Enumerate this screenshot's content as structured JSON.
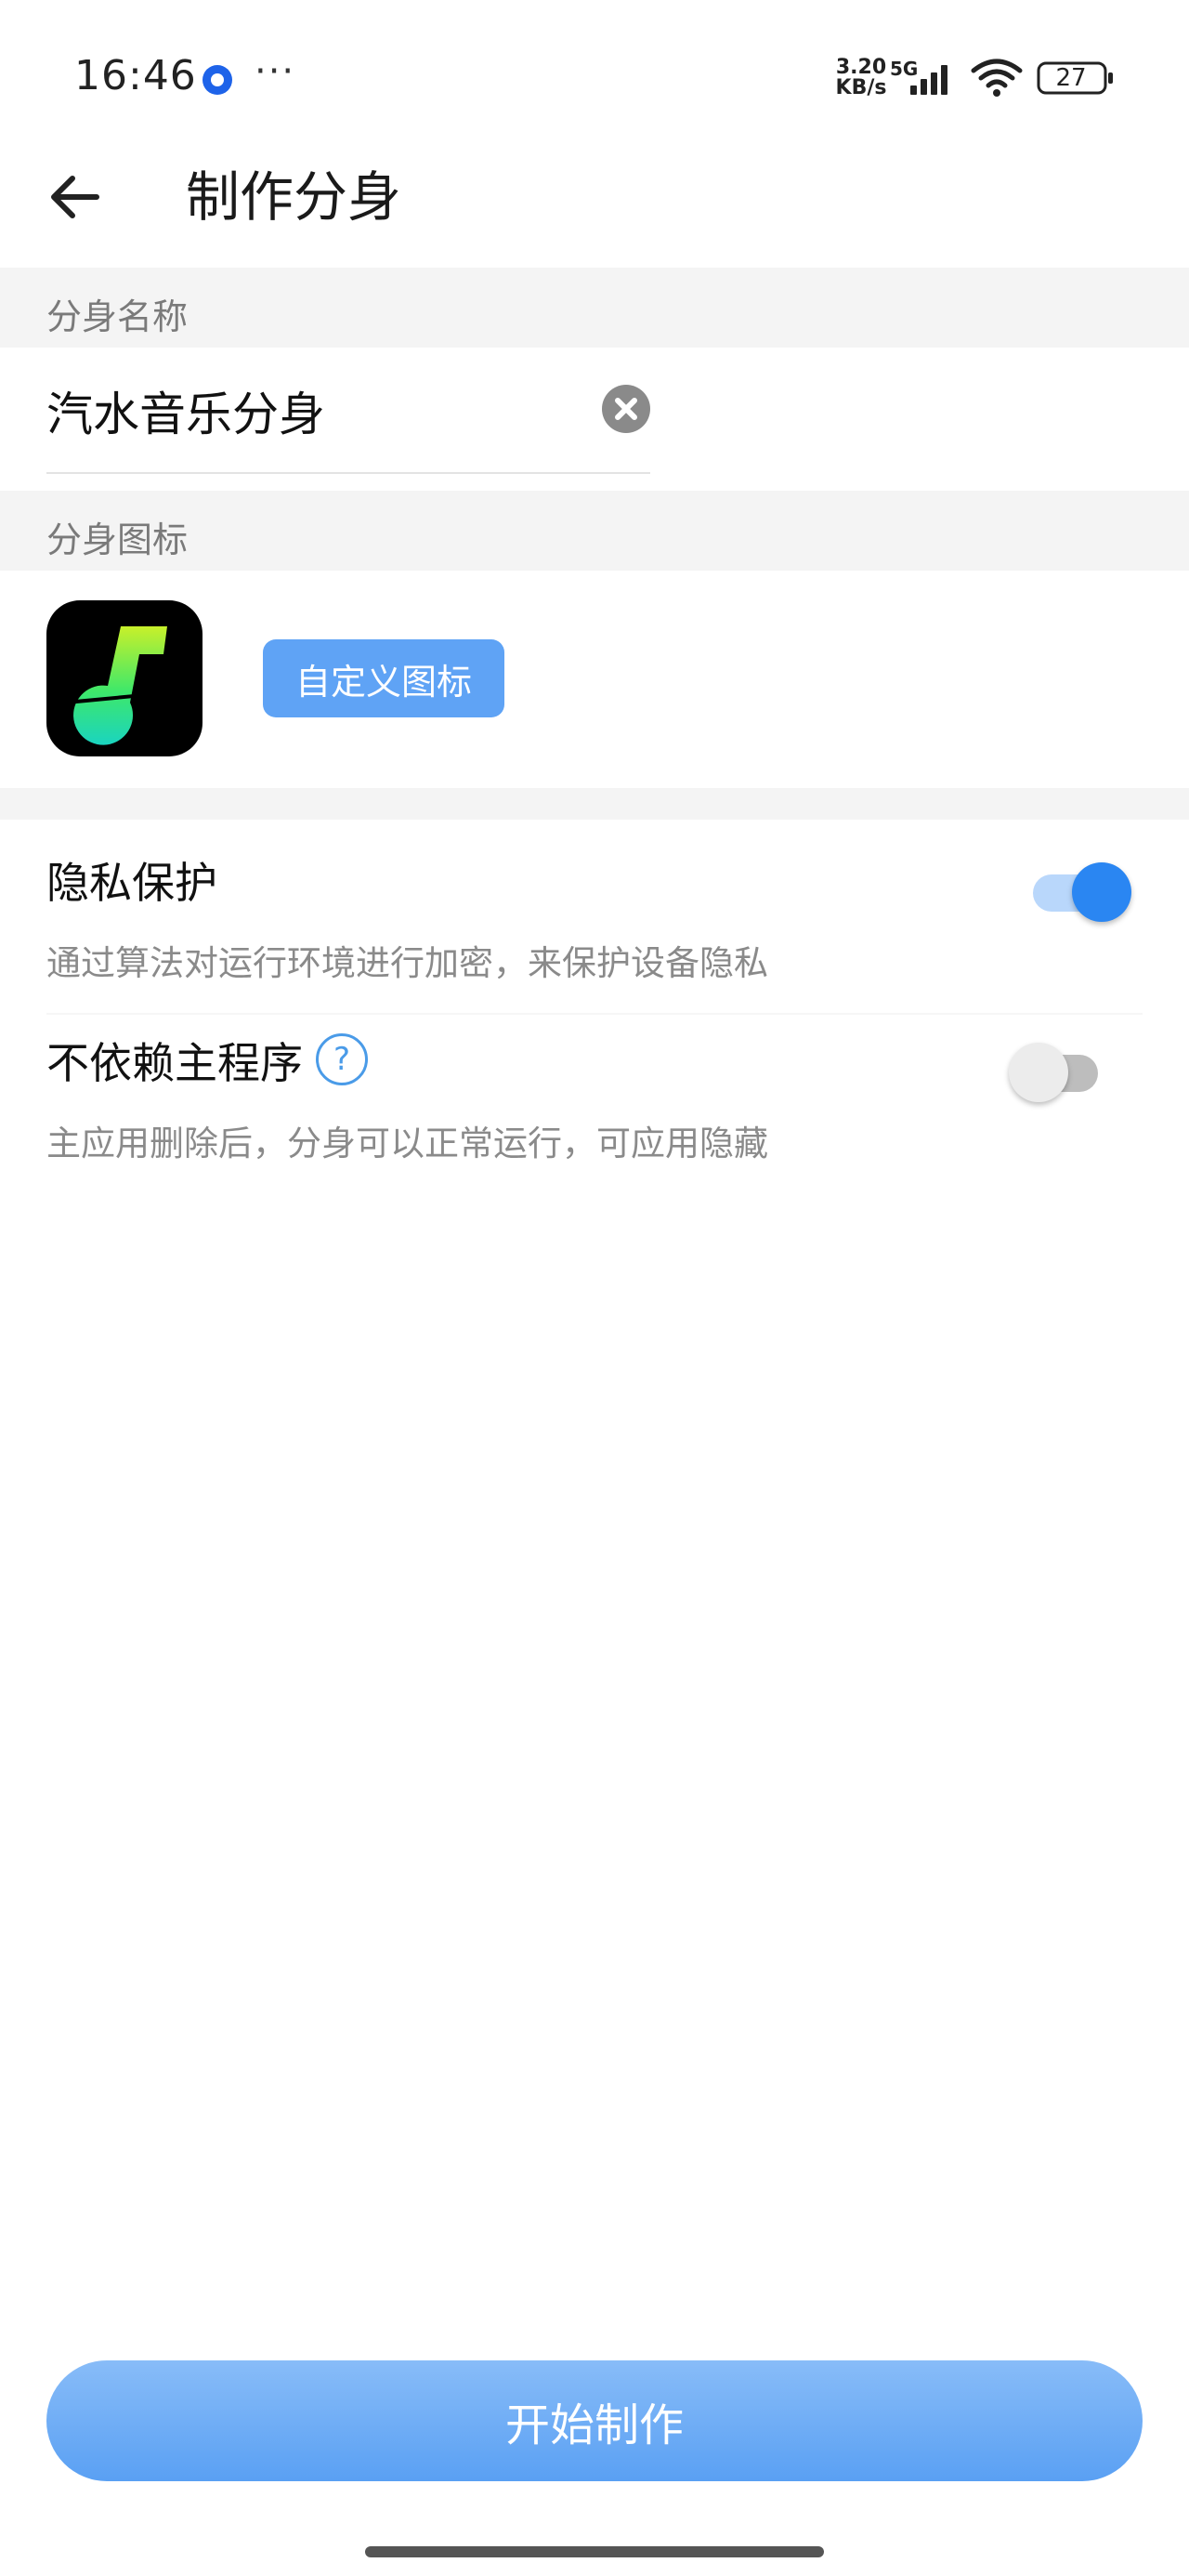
{
  "status_bar": {
    "time": "16:46",
    "more": "···",
    "speed_value": "3.20",
    "speed_unit": "KB/s",
    "network": "5G",
    "battery": "27"
  },
  "header": {
    "title": "制作分身"
  },
  "name_section": {
    "label": "分身名称",
    "value": "汽水音乐分身"
  },
  "icon_section": {
    "label": "分身图标",
    "custom_button": "自定义图标"
  },
  "settings": [
    {
      "title": "隐私保护",
      "description": "通过算法对运行环境进行加密，来保护设备隐私",
      "enabled": true
    },
    {
      "title": "不依赖主程序",
      "description": "主应用删除后，分身可以正常运行，可应用隐藏",
      "enabled": false,
      "help": "?"
    }
  ],
  "start_button": "开始制作",
  "colors": {
    "accent": "#2a86f2",
    "button": "#5fa3f5",
    "section_bg": "#f4f4f4"
  },
  "icons": {
    "back": "arrow-left-icon",
    "clear": "close-circle-icon",
    "help": "question-circle-icon",
    "app": "soda-music-app-icon"
  }
}
